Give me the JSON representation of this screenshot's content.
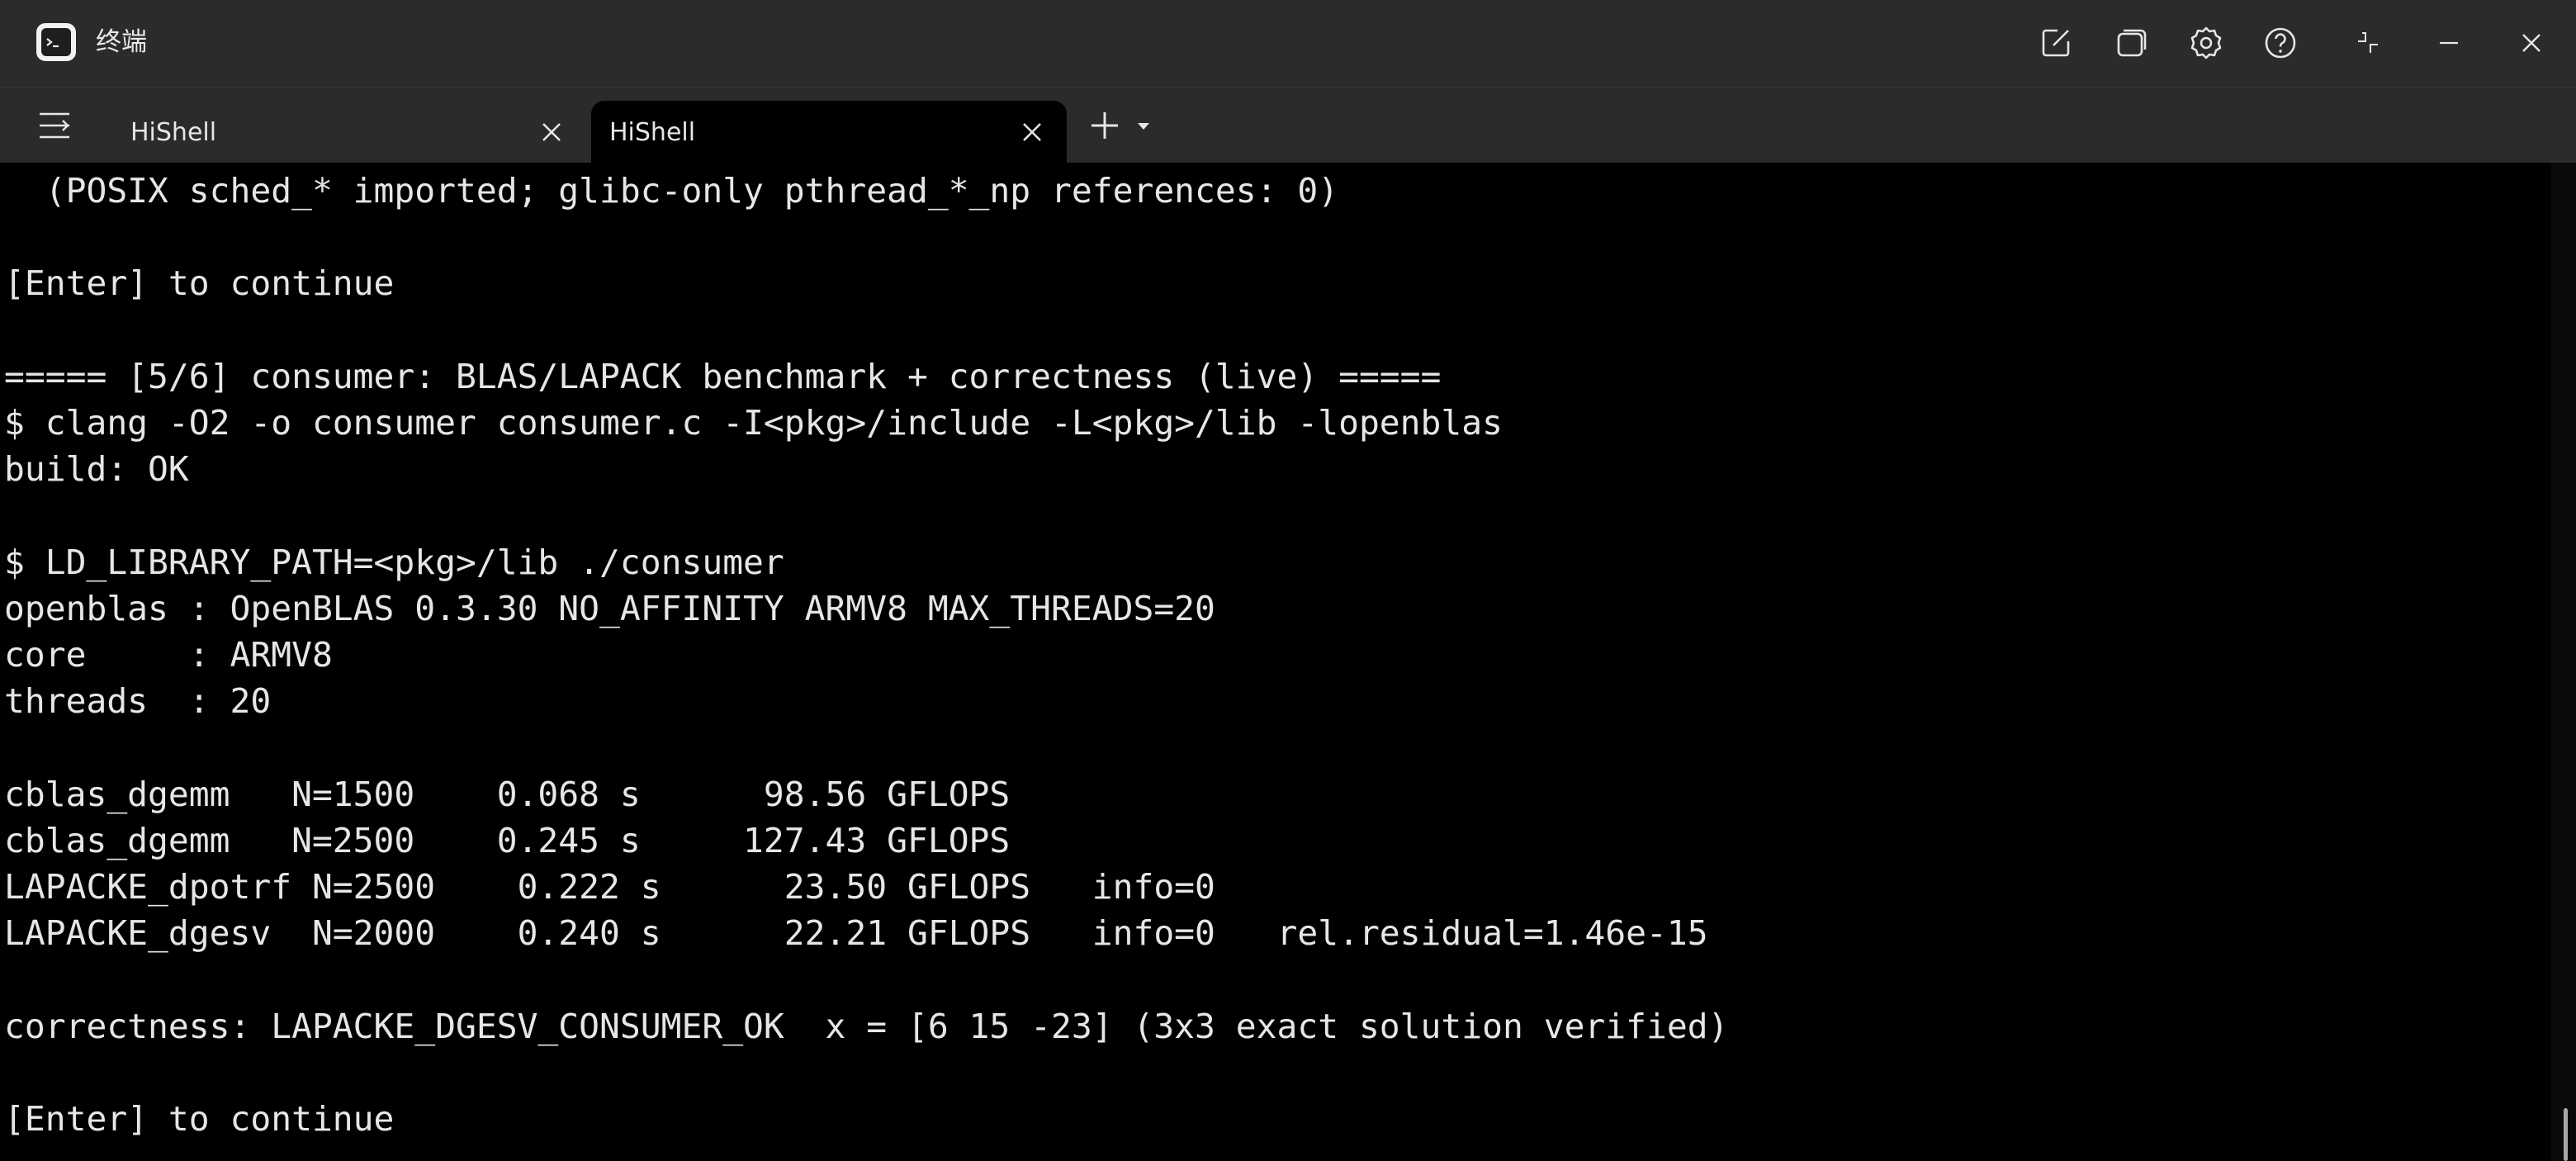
{
  "window": {
    "title": "终端",
    "app_icon": "terminal-app-icon",
    "controls": [
      "new-window-icon",
      "multi-window-icon",
      "settings-gear-icon",
      "help-icon",
      "restore-icon",
      "minimize-icon",
      "close-icon"
    ]
  },
  "tabs": [
    {
      "label": "HiShell",
      "active": false
    },
    {
      "label": "HiShell",
      "active": true
    }
  ],
  "tabbar": {
    "menu_icon": "tab-menu-icon",
    "new_tab_icon": "plus-icon",
    "dropdown_icon": "caret-down-icon"
  },
  "terminal": {
    "lines": [
      "  (POSIX sched_* imported; glibc-only pthread_*_np references: 0)",
      "",
      "[Enter] to continue",
      "",
      "===== [5/6] consumer: BLAS/LAPACK benchmark + correctness (live) =====",
      "$ clang -O2 -o consumer consumer.c -I<pkg>/include -L<pkg>/lib -lopenblas",
      "build: OK",
      "",
      "$ LD_LIBRARY_PATH=<pkg>/lib ./consumer",
      "openblas : OpenBLAS 0.3.30 NO_AFFINITY ARMV8 MAX_THREADS=20",
      "core     : ARMV8",
      "threads  : 20",
      "",
      "cblas_dgemm   N=1500    0.068 s      98.56 GFLOPS",
      "cblas_dgemm   N=2500    0.245 s     127.43 GFLOPS",
      "LAPACKE_dpotrf N=2500    0.222 s      23.50 GFLOPS   info=0",
      "LAPACKE_dgesv  N=2000    0.240 s      22.21 GFLOPS   info=0   rel.residual=1.46e-15",
      "",
      "correctness: LAPACKE_DGESV_CONSUMER_OK  x = [6 15 -23] (3x3 exact solution verified)",
      "",
      "[Enter] to continue"
    ]
  },
  "colors": {
    "chrome": "#2b2b2b",
    "terminal_bg": "#000000",
    "terminal_fg": "#e6e6e6"
  }
}
